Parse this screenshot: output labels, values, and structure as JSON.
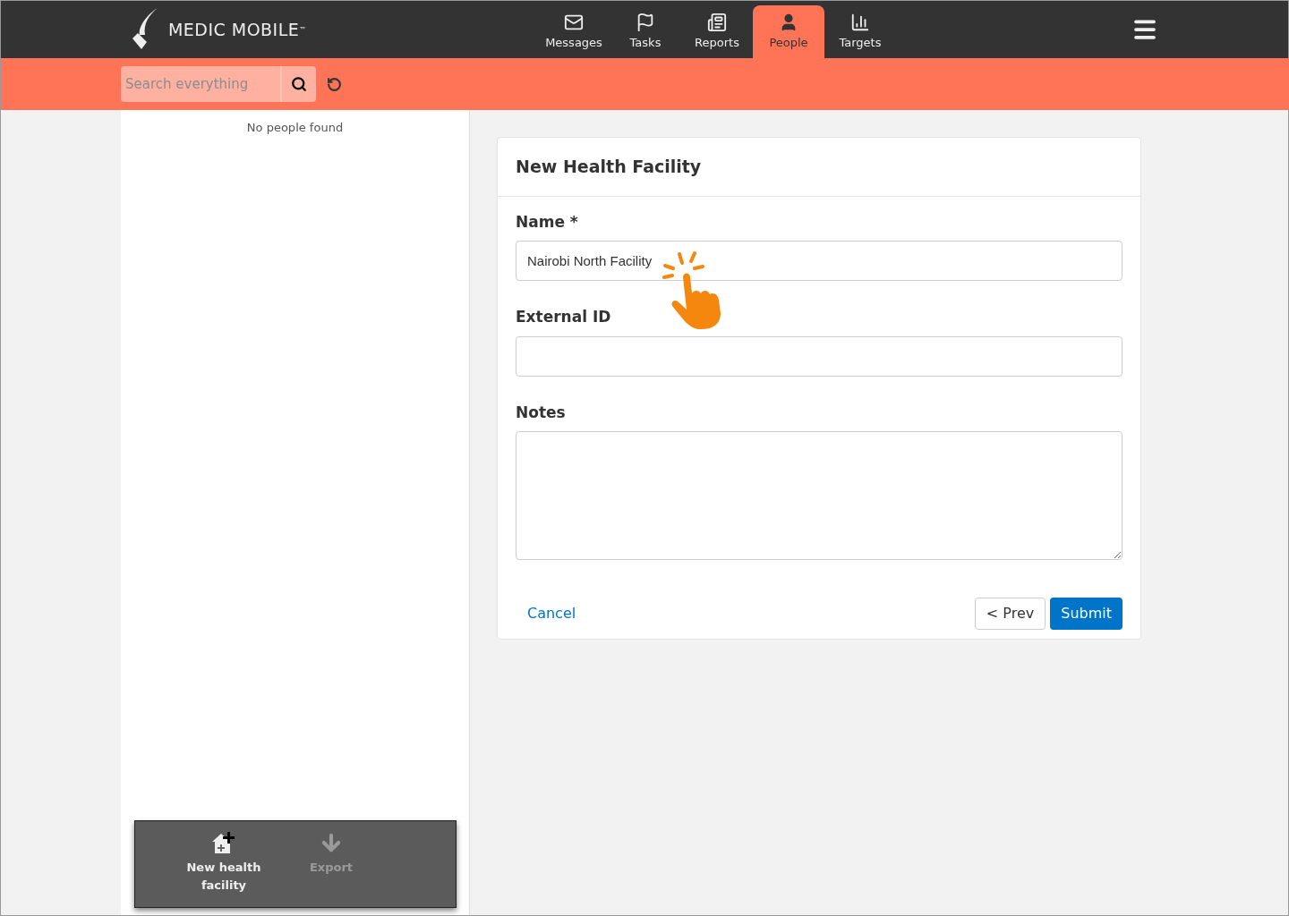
{
  "header": {
    "logo_text": "MEDIC MOBILE",
    "trademark": "™"
  },
  "nav": [
    {
      "label": "Messages",
      "selected": false
    },
    {
      "label": "Tasks",
      "selected": false
    },
    {
      "label": "Reports",
      "selected": false
    },
    {
      "label": "People",
      "selected": true
    },
    {
      "label": "Targets",
      "selected": false
    }
  ],
  "search": {
    "placeholder": "Search everything"
  },
  "people_list": {
    "empty_message": "No people found"
  },
  "actions": [
    {
      "label": "New health facility",
      "disabled": false
    },
    {
      "label": "Export",
      "disabled": true
    }
  ],
  "form": {
    "title": "New Health Facility",
    "fields": [
      {
        "label": "Name *",
        "kind": "text",
        "value": "Nairobi North Facility"
      },
      {
        "label": "External ID",
        "kind": "text"
      },
      {
        "label": "Notes",
        "kind": "textarea"
      }
    ],
    "cancel": "Cancel",
    "prev": "< Prev",
    "submit": "Submit"
  }
}
